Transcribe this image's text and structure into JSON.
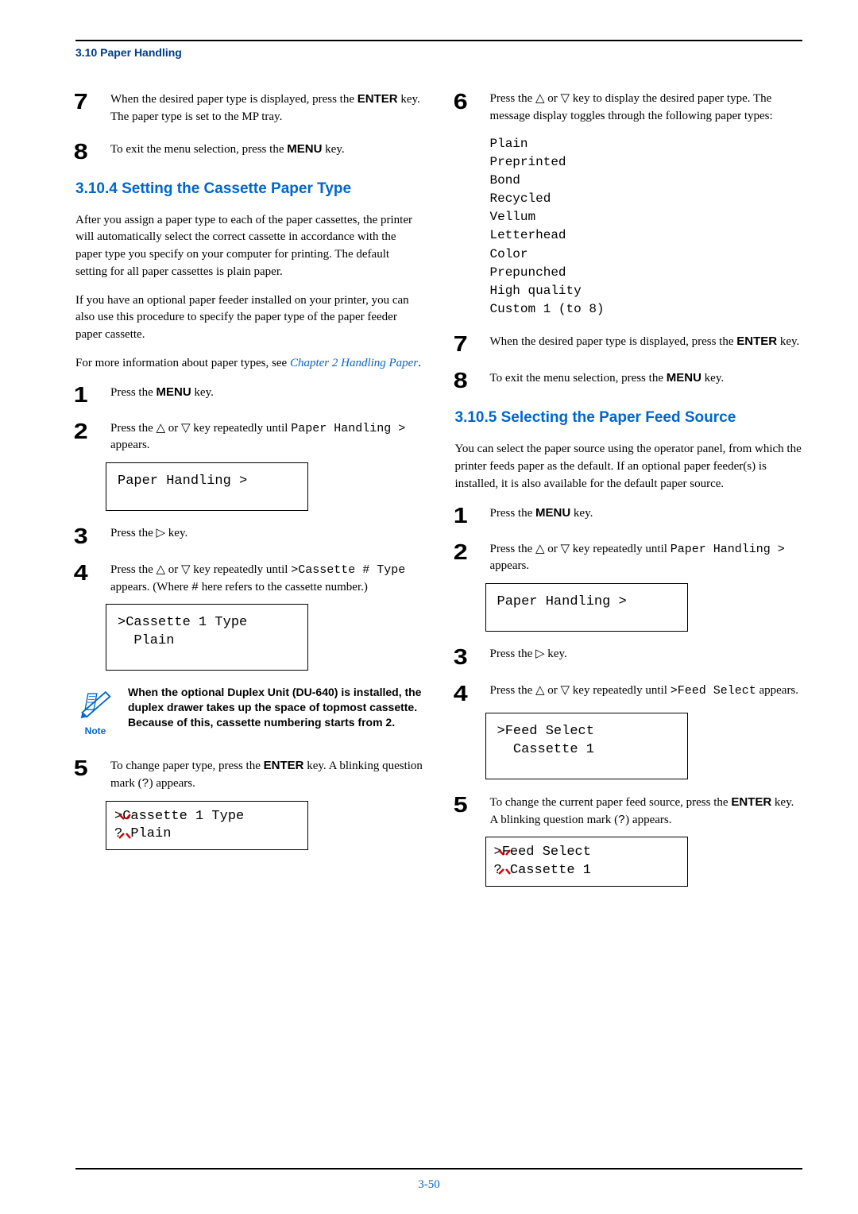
{
  "header": {
    "breadcrumb": "3.10 Paper Handling"
  },
  "left": {
    "step7": {
      "num": "7",
      "text_a": "When the desired paper type is displayed, press the ",
      "key": "ENTER",
      "text_b": " key. The paper type is set to the MP tray."
    },
    "step8": {
      "num": "8",
      "text_a": "To exit the menu selection, press the ",
      "key": "MENU",
      "text_b": " key."
    },
    "h3": "3.10.4   Setting the Cassette Paper Type",
    "p1": "After you assign a paper type to each of the paper cassettes, the printer will automatically select the correct cassette in accordance with the paper type you specify on your computer for printing. The default setting for all paper cassettes is plain paper.",
    "p2": "If you have an optional paper feeder installed on your printer, you can also use this procedure to specify the paper type of the paper feeder paper cassette.",
    "p3_a": "For more information about paper types, see ",
    "p3_link": "Chapter 2 Handling Paper",
    "p3_b": ".",
    "s1": {
      "num": "1",
      "text_a": "Press the ",
      "key": "MENU",
      "text_b": " key."
    },
    "s2": {
      "num": "2",
      "text_a": "Press the △ or ▽ key repeatedly until ",
      "mono": "Paper Handling >",
      "text_b": " appears."
    },
    "s2_display": "Paper Handling >",
    "s3": {
      "num": "3",
      "text": "Press the ▷ key."
    },
    "s4": {
      "num": "4",
      "text_a": "Press the △ or ▽ key repeatedly until ",
      "mono1": ">Cassette # Type",
      "text_b": " appears. (Where ",
      "mono2": "#",
      "text_c": " here refers to the cassette number.)"
    },
    "s4_display": ">Cassette 1 Type\n  Plain",
    "note": {
      "label": "Note",
      "text": "When the optional Duplex Unit (DU-640) is installed, the duplex drawer takes up the space of topmost cassette. Because of this, cassette numbering starts from 2."
    },
    "s5": {
      "num": "5",
      "text_a": "To change paper type, press the ",
      "key": "ENTER",
      "text_b": " key. A blinking question mark (",
      "q": "?",
      "text_c": ") appears."
    },
    "s5_display_l1": ">Cassette 1 Type",
    "s5_display_l2": "? Plain"
  },
  "right": {
    "s6": {
      "num": "6",
      "text": "Press the △ or ▽ key to display the desired paper type. The message display toggles through the following paper types:"
    },
    "types": "Plain\nPreprinted\nBond\nRecycled\nVellum\nLetterhead\nColor\nPrepunched\nHigh quality\nCustom 1 (to 8)",
    "s7": {
      "num": "7",
      "text_a": "When the desired paper type is displayed, press the ",
      "key": "ENTER",
      "text_b": " key."
    },
    "s8": {
      "num": "8",
      "text_a": "To exit the menu selection, press the ",
      "key": "MENU",
      "text_b": " key."
    },
    "h3": "3.10.5   Selecting the Paper Feed Source",
    "p1": "You can select the paper source using the operator panel, from which the printer feeds paper as the default. If an optional paper feeder(s) is installed, it is also available for the default paper source.",
    "r1": {
      "num": "1",
      "text_a": "Press the ",
      "key": "MENU",
      "text_b": " key."
    },
    "r2": {
      "num": "2",
      "text_a": "Press the △ or ▽ key repeatedly until ",
      "mono": "Paper Handling >",
      "text_b": " appears."
    },
    "r2_display": "Paper Handling >",
    "r3": {
      "num": "3",
      "text": "Press the ▷ key."
    },
    "r4": {
      "num": "4",
      "text_a": "Press the △ or ▽ key repeatedly until ",
      "mono": ">Feed Select",
      "text_b": " appears."
    },
    "r4_display": ">Feed Select\n  Cassette 1",
    "r5": {
      "num": "5",
      "text_a": "To change the current paper feed source, press the ",
      "key": "ENTER",
      "text_b": " key. A blinking question mark (",
      "q": "?",
      "text_c": ") appears."
    },
    "r5_display_l1": ">Feed Select",
    "r5_display_l2": "? Cassette 1"
  },
  "footer": {
    "page": "3-50"
  }
}
